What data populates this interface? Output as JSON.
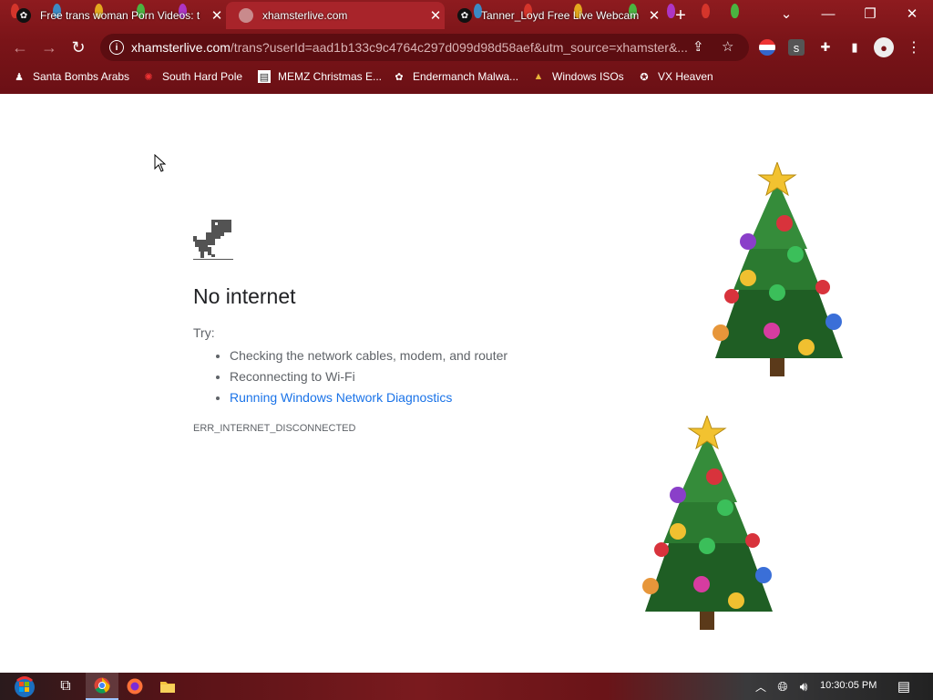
{
  "browser": {
    "tabs": [
      {
        "title": "Free trans woman Porn Videos: t",
        "active": false
      },
      {
        "title": "xhamsterlive.com",
        "active": true
      },
      {
        "title": "Tanner_Loyd Free Live Webcam",
        "active": false
      }
    ],
    "new_tab_label": "+",
    "url_host": "xhamsterlive.com",
    "url_path": "/trans?userId=aad1b133c9c4764c297d099d98d58aef&utm_source=xhamster&...",
    "bookmarks": [
      {
        "label": "Santa Bombs Arabs",
        "icon": "bomb-icon"
      },
      {
        "label": "South Hard Pole",
        "icon": "spark-icon"
      },
      {
        "label": "MEMZ Christmas E...",
        "icon": "page-icon"
      },
      {
        "label": "Endermanch Malwa...",
        "icon": "raccoon-icon"
      },
      {
        "label": "Windows ISOs",
        "icon": "tree-icon"
      },
      {
        "label": "VX Heaven",
        "icon": "vx-icon"
      }
    ]
  },
  "error_page": {
    "title": "No internet",
    "try_label": "Try:",
    "suggestions": [
      "Checking the network cables, modem, and router",
      "Reconnecting to Wi-Fi"
    ],
    "diagnostics_link": "Running Windows Network Diagnostics",
    "error_code": "ERR_INTERNET_DISCONNECTED"
  },
  "taskbar": {
    "clock": "10:30:05 PM"
  },
  "colors": {
    "chrome": "#7a1418",
    "link": "#1a73e8",
    "title_text": "#202124",
    "body_text": "#5f6368"
  }
}
